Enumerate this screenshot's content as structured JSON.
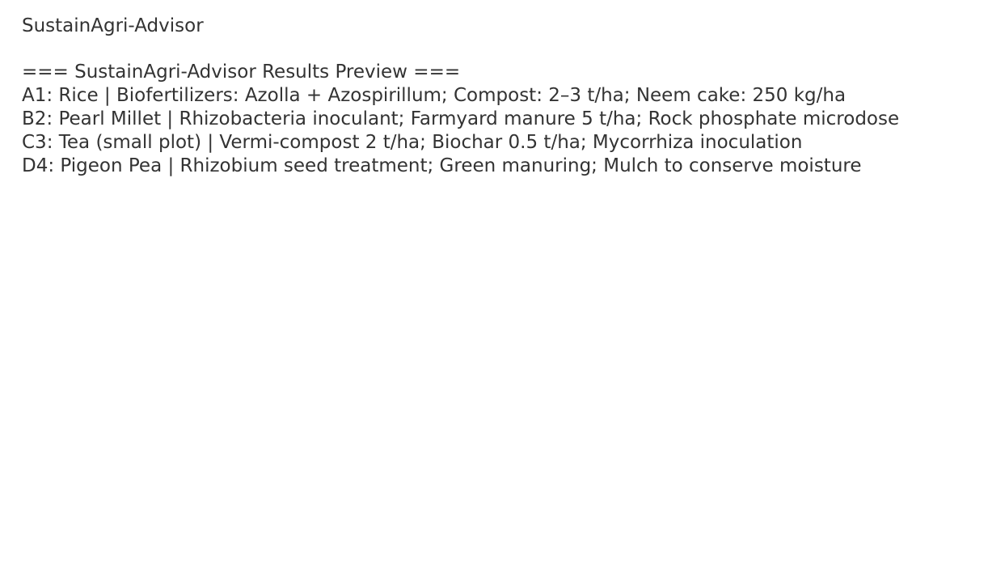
{
  "app": {
    "title": "SustainAgri-Advisor"
  },
  "results": {
    "header": "=== SustainAgri-Advisor Results Preview ===",
    "lines": [
      "A1: Rice | Biofertilizers: Azolla + Azospirillum; Compost: 2–3 t/ha; Neem cake: 250 kg/ha",
      "B2: Pearl Millet | Rhizobacteria inoculant; Farmyard manure 5 t/ha; Rock phosphate microdose",
      "C3: Tea (small plot) | Vermi-compost 2 t/ha; Biochar 0.5 t/ha; Mycorrhiza inoculation",
      "D4: Pigeon Pea | Rhizobium seed treatment; Green manuring; Mulch to conserve moisture"
    ]
  },
  "colors": {
    "text": "#333333",
    "background": "#ffffff"
  }
}
